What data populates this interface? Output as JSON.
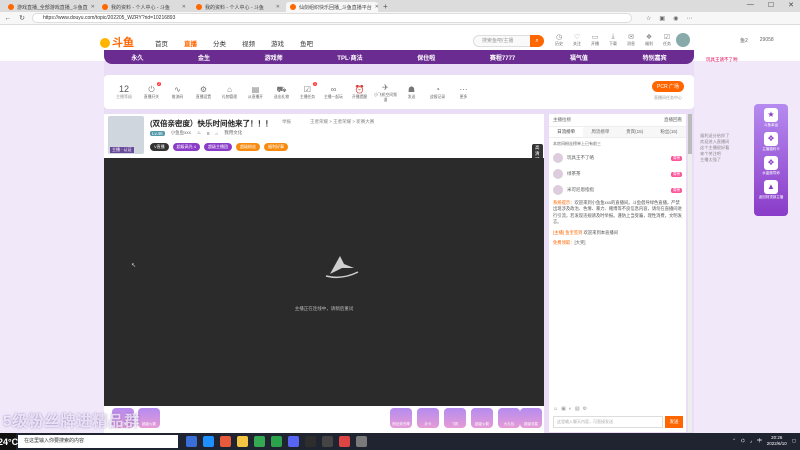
{
  "browser": {
    "tabs": [
      {
        "title": "游戏直播_全部游戏直播_斗鱼直",
        "active": false
      },
      {
        "title": "我的资料 - 个人中心 - 斗鱼",
        "active": false
      },
      {
        "title": "我的资料 - 个人中心 - 斗鱼",
        "active": false
      },
      {
        "title": "仙剑组织快乐回播_斗鱼直播平台",
        "active": true
      }
    ],
    "new_tab": "+",
    "url": "https://www.douyu.com/topic/202205_WZRY?rid=10216893"
  },
  "header": {
    "logo": "斗鱼",
    "nav": [
      "首页",
      "直播",
      "分类",
      "视频",
      "游戏",
      "鱼吧"
    ],
    "nav_active": "直播",
    "search_placeholder": "搜索鱼吧/主播",
    "icons": [
      {
        "label": "历史",
        "icon": "history-icon"
      },
      {
        "label": "关注",
        "icon": "heart-icon"
      },
      {
        "label": "开播",
        "icon": "camera-icon"
      },
      {
        "label": "下载",
        "icon": "download-icon"
      },
      {
        "label": "消息",
        "icon": "message-icon"
      },
      {
        "label": "福利",
        "icon": "gift-icon"
      },
      {
        "label": "任务",
        "icon": "task-icon"
      }
    ],
    "right_items": [
      "鱼2",
      "29058"
    ]
  },
  "banner_items": [
    "永久",
    "金生",
    "游戏师",
    "TPL·商法",
    "保住啦",
    "赛程7777",
    "福气值",
    "特别嘉宾"
  ],
  "toolbar": {
    "level": "12",
    "level_label": "主播等级",
    "tools": [
      {
        "label": "直播开关",
        "badge": "2"
      },
      {
        "label": "推流码",
        "badge": ""
      },
      {
        "label": "直播设置",
        "badge": ""
      },
      {
        "label": "礼物管理",
        "badge": ""
      },
      {
        "label": "从直播开",
        "badge": ""
      },
      {
        "label": "送出礼物",
        "badge": ""
      },
      {
        "label": "主播任务",
        "badge": "1"
      },
      {
        "label": "主播一起玩",
        "badge": ""
      },
      {
        "label": "开播提醒",
        "badge": ""
      },
      {
        "label": "小飞机空间频道",
        "badge": ""
      },
      {
        "label": "发送",
        "badge": ""
      },
      {
        "label": "战报记录",
        "badge": ""
      },
      {
        "label": "更多",
        "badge": ""
      }
    ],
    "pcr_label": "PCR 广场",
    "pcr_sub": "直播间任务中心"
  },
  "stream": {
    "title": "(双倍亲密度）快乐时间他来了！！！",
    "report": "举报",
    "breadcrumb": "王者荣耀 > 王者荣耀 > 新赛大赛",
    "level_badge": "Lv.46",
    "streamer": "小鱼鱼xxx",
    "followers": "8",
    "org": "我用文化",
    "tags": [
      {
        "text": "V直播",
        "style": "d"
      },
      {
        "text": "超级高光 4",
        "style": "p"
      },
      {
        "text": "超级主播团",
        "style": "p"
      },
      {
        "text": "超级粉丝",
        "style": "o"
      },
      {
        "text": "福利好事",
        "style": "o"
      }
    ],
    "avatar_tag": "主播 · 认证",
    "follow_count": "20050",
    "follow_label": "关注",
    "hd_label": "高清可看 1 / 1分享",
    "share": "分享",
    "client": "客户端打开",
    "video_message": "主播正在连线中，请稍后重试"
  },
  "gifts": [
    "点赞",
    "超级火箭",
    "粉丝荧光棒",
    "办卡",
    "飞机",
    "超级火箭",
    "大礼包",
    "超级流星"
  ],
  "chat": {
    "top_left": "主播拉榜",
    "top_right": "直播回看",
    "tabs": [
      "日流榜单",
      "周流榜单",
      "贵宾(15)",
      "粉丝(15)"
    ],
    "notice": "本房间粉丝榜单上已有前三",
    "vips": [
      {
        "name": "玩具王不了咯",
        "badge": "周榜"
      },
      {
        "name": "绿茶茶",
        "badge": "周榜"
      },
      {
        "name": "米可尼恩指指",
        "badge": "周榜"
      }
    ],
    "system_label": "系统提示：",
    "system_text": "欢迎来到小鱼鱼xxx的直播间。斗鱼倡导绿色直播，严禁出现涉及政治、色情、暴力、赌博等不良信息内容，请勿在直播间进行引流，若发现违规请及时举报。谨防上当受骗，理性消费，文明发言。",
    "line_user": "[主播]",
    "line_user2": "鱼宝签到",
    "line_text": "欢迎来到本直播间",
    "gift_line_label": "免费领取：",
    "gift_line_text": "[大奖]",
    "input_placeholder": "这里输入聊天内容，可直接发送",
    "send": "发送"
  },
  "right_panel": {
    "top_text": "玩具王请不了哟",
    "mini_chat": [
      "福利送分给你了",
      "欢迎进入直播间",
      "这个主播很好看",
      "来个关注吧",
      "主播太强了"
    ],
    "float_items": [
      {
        "label": "斗鱼幸运",
        "icon": "trophy-icon"
      },
      {
        "label": "主播福利卡",
        "icon": "card-icon"
      },
      {
        "label": "水晶魔导师",
        "icon": "crystal-icon"
      },
      {
        "label": "返回到顶部主播",
        "icon": "top-icon"
      }
    ]
  },
  "watermark": "5级粉丝牌进精品群",
  "taskbar": {
    "search_placeholder": "在这里输入你要搜索的内容",
    "time": "20:26",
    "date": "2022/6/10",
    "weather": "24°C",
    "lang": "中"
  },
  "colors": {
    "accent": "#ff6600",
    "brand_purple": "#6a2c91",
    "page_bg": "#e9def6"
  }
}
